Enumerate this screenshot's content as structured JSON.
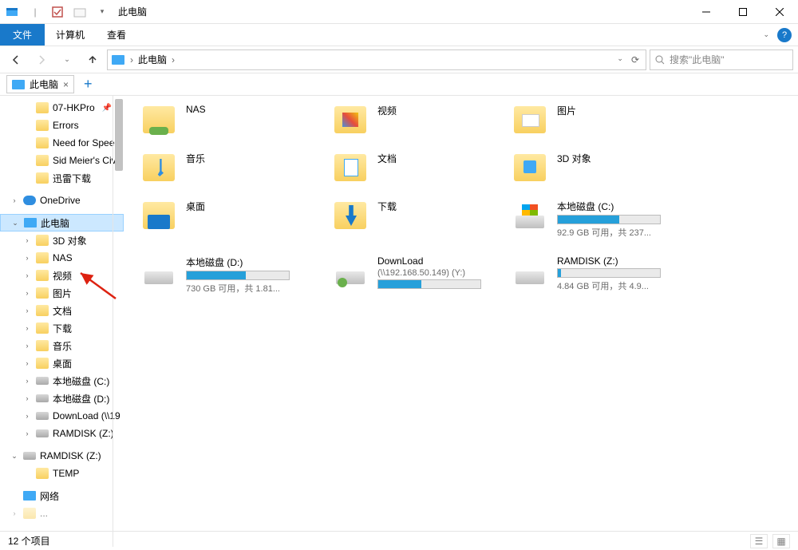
{
  "titlebar": {
    "title": "此电脑"
  },
  "ribbon": {
    "file": "文件",
    "tabs": [
      {
        "label": "计算机"
      },
      {
        "label": "查看"
      }
    ]
  },
  "nav": {
    "breadcrumb": [
      {
        "label": "此电脑"
      }
    ]
  },
  "search": {
    "placeholder": "搜索\"此电脑\""
  },
  "docTabs": [
    {
      "label": "此电脑"
    }
  ],
  "sidebar": {
    "quick": [
      {
        "label": "07-HKPro",
        "pinned": true
      },
      {
        "label": "Errors"
      },
      {
        "label": "Need for Speec"
      },
      {
        "label": "Sid Meier's Civil"
      },
      {
        "label": "迅雷下载"
      }
    ],
    "onedrive": "OneDrive",
    "thispc": "此电脑",
    "thispc_children": [
      {
        "label": "3D 对象",
        "icon": "obj"
      },
      {
        "label": "NAS",
        "icon": "folder"
      },
      {
        "label": "视频",
        "icon": "vid"
      },
      {
        "label": "图片",
        "icon": "pic"
      },
      {
        "label": "文档",
        "icon": "doc"
      },
      {
        "label": "下载",
        "icon": "dl"
      },
      {
        "label": "音乐",
        "icon": "mus"
      },
      {
        "label": "桌面",
        "icon": "dsk"
      },
      {
        "label": "本地磁盘 (C:)",
        "icon": "drive"
      },
      {
        "label": "本地磁盘 (D:)",
        "icon": "drive"
      },
      {
        "label": "DownLoad (\\\\19",
        "icon": "drive"
      },
      {
        "label": "RAMDISK (Z:)",
        "icon": "drive"
      }
    ],
    "ramdisk": "RAMDISK (Z:)",
    "ramdisk_children": [
      {
        "label": "TEMP"
      }
    ],
    "network": "网络"
  },
  "content": {
    "folders": [
      {
        "label": "NAS",
        "icon": "nas"
      },
      {
        "label": "视频",
        "icon": "vid"
      },
      {
        "label": "图片",
        "icon": "pic"
      },
      {
        "label": "音乐",
        "icon": "mus"
      },
      {
        "label": "文档",
        "icon": "doc"
      },
      {
        "label": "3D 对象",
        "icon": "obj"
      },
      {
        "label": "桌面",
        "icon": "dsk"
      },
      {
        "label": "下载",
        "icon": "dl"
      }
    ],
    "drives": [
      {
        "label": "本地磁盘 (C:)",
        "sub": "92.9 GB 可用，共 237...",
        "fill": 60,
        "icon": "windows"
      },
      {
        "label": "本地磁盘 (D:)",
        "sub": "730 GB 可用，共 1.81...",
        "fill": 58,
        "icon": "plain"
      },
      {
        "label": "DownLoad",
        "sub2": "(\\\\192.168.50.149) (Y:)",
        "fill": 42,
        "icon": "net"
      },
      {
        "label": "RAMDISK (Z:)",
        "sub": "4.84 GB 可用，共 4.9...",
        "fill": 3,
        "icon": "plain"
      }
    ]
  },
  "status": {
    "count": "12 个项目"
  }
}
